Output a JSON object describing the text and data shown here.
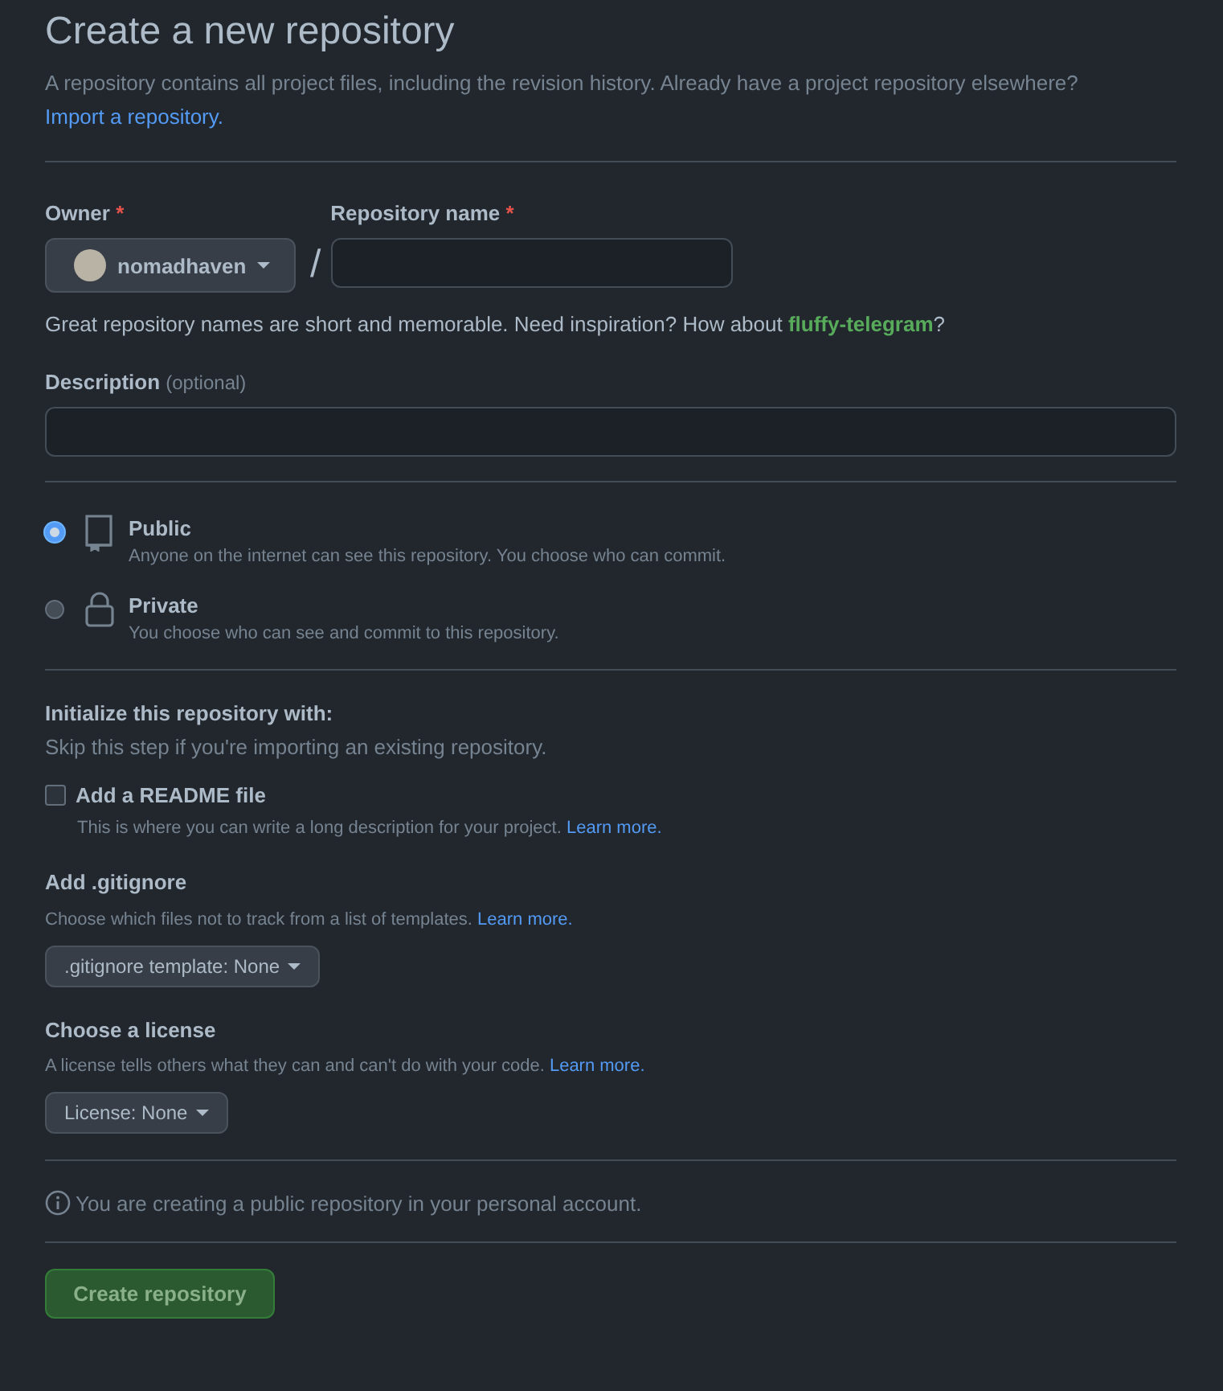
{
  "heading": "Create a new repository",
  "intro": "A repository contains all project files, including the revision history. Already have a project repository elsewhere?",
  "import_link": "Import a repository.",
  "owner": {
    "label": "Owner",
    "required_mark": "*",
    "value": "nomadhaven"
  },
  "separator": "/",
  "repo_name": {
    "label": "Repository name",
    "required_mark": "*"
  },
  "name_hint": {
    "text": "Great repository names are short and memorable. Need inspiration? How about",
    "suggestion": "fluffy-telegram",
    "tail": "?"
  },
  "description": {
    "label": "Description",
    "optional": "(optional)"
  },
  "visibility": [
    {
      "kind": "public",
      "label": "Public",
      "note": "Anyone on the internet can see this repository. You choose who can commit.",
      "selected": true
    },
    {
      "kind": "private",
      "label": "Private",
      "note": "You choose who can see and commit to this repository.",
      "selected": false
    }
  ],
  "initialize": {
    "title": "Initialize this repository with:",
    "subtitle": "Skip this step if you're importing an existing repository.",
    "readme": {
      "label": "Add a README file",
      "checked": false,
      "note": "This is where you can write a long description for your project.",
      "link": "Learn more."
    }
  },
  "gitignore": {
    "title": "Add .gitignore",
    "note": "Choose which files not to track from a list of templates.",
    "link": "Learn more.",
    "button": ".gitignore template: None"
  },
  "license": {
    "title": "Choose a license",
    "note": "A license tells others what they can and can't do with your code.",
    "link": "Learn more.",
    "button": "License: None"
  },
  "notice": "You are creating a public repository in your personal account.",
  "submit": "Create repository"
}
